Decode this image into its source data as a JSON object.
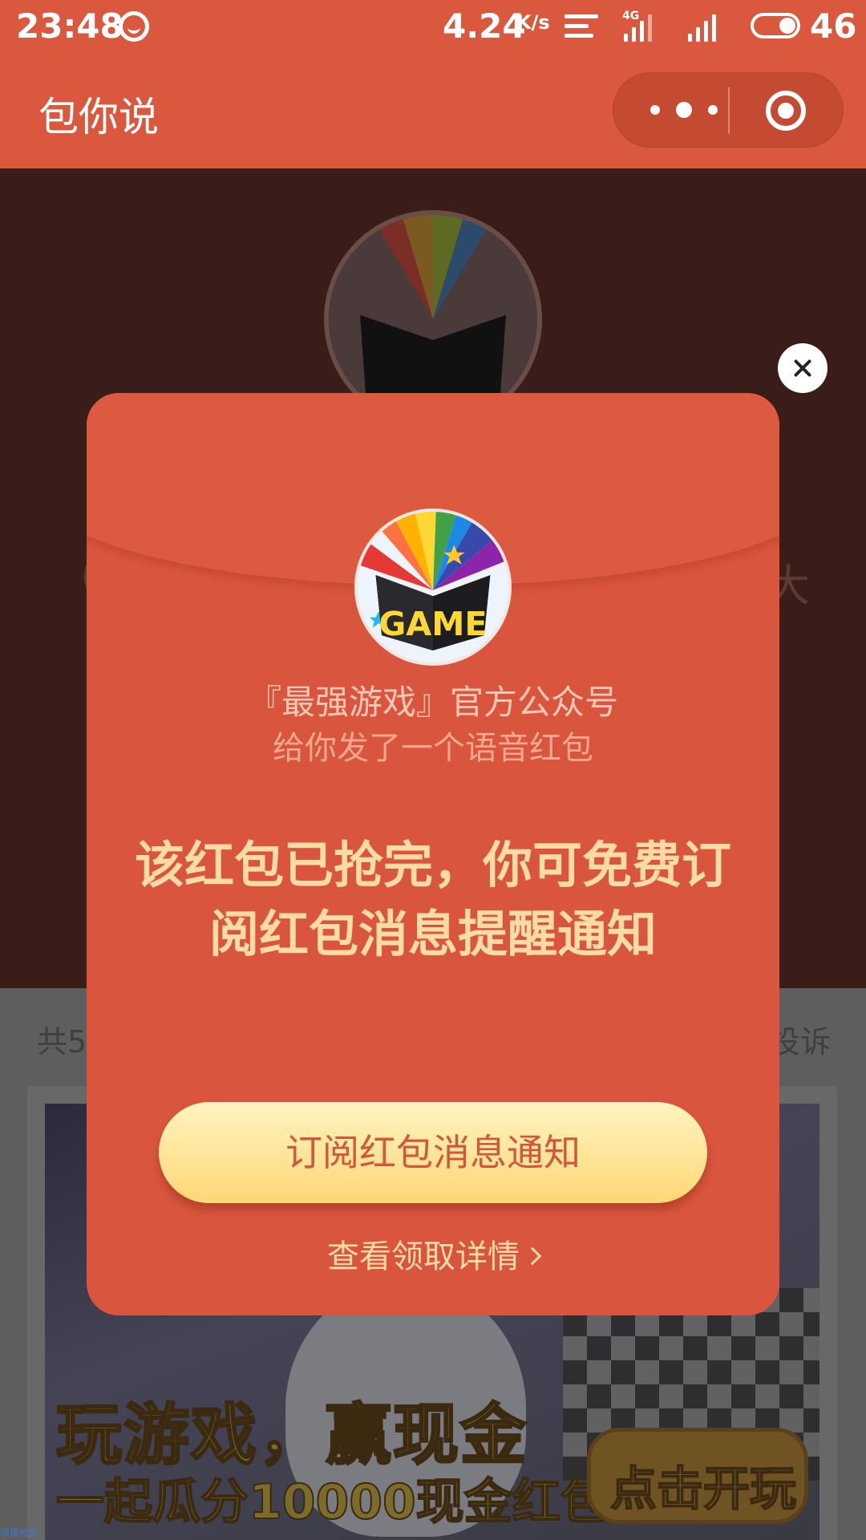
{
  "status_bar": {
    "time": "23:48",
    "speed": "4.24",
    "speed_unit": "K/s",
    "network": "4G",
    "battery": "46"
  },
  "header": {
    "title": "包你说"
  },
  "background": {
    "side_text_left": "(",
    "side_text_right": "大",
    "count_text": "共5",
    "report_text": "投诉",
    "banner": {
      "headline": "玩游戏，赢现金",
      "subline": "一起瓜分10000现金红包!",
      "button_label": "点击开玩"
    },
    "watermark": "浪尾社区"
  },
  "modal": {
    "logo_text": "GAME",
    "sender": "『最强游戏』官方公众号",
    "description": "给你发了一个语音红包",
    "message": "该红包已抢完，你可免费订阅红包消息提醒通知",
    "subscribe_button": "订阅红包消息通知",
    "detail_link": "查看领取详情"
  },
  "colors": {
    "brand_red": "#d9583e",
    "modal_red": "#d9553e",
    "gold_text": "#fcdba6",
    "button_yellow": "#ffd776"
  }
}
